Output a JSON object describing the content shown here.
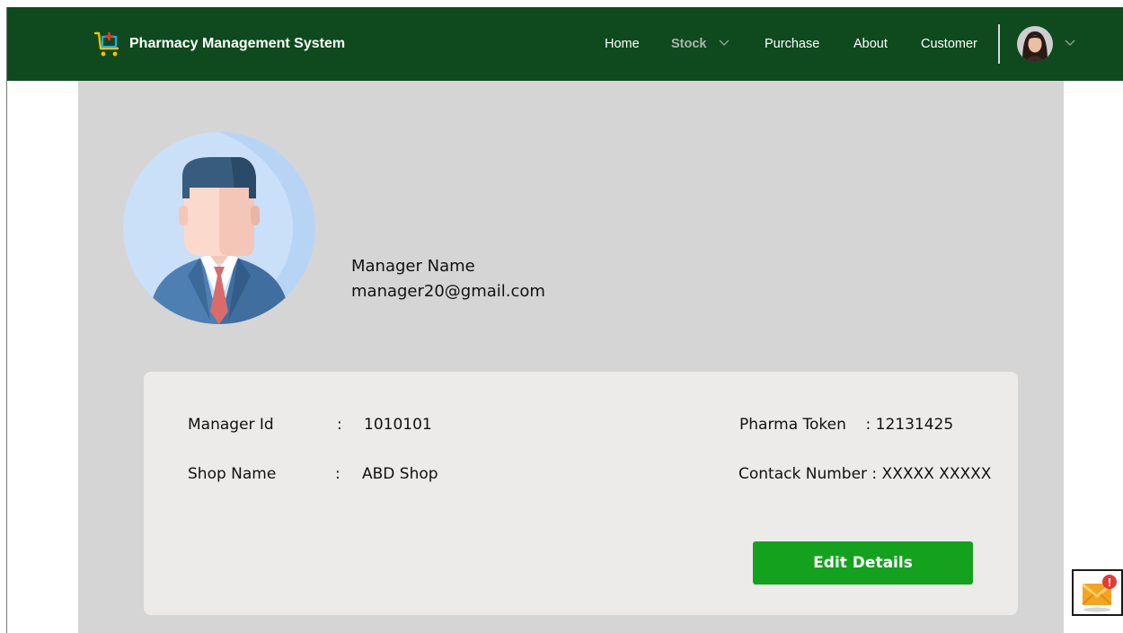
{
  "navbar": {
    "brand_title": "Pharmacy Management System",
    "bg_color": "#0e4a1e",
    "links": {
      "home": "Home",
      "stock": "Stock",
      "purchase": "Purchase",
      "about": "About",
      "customer": "Customer"
    },
    "icons": [
      "pharmacy-cart-logo-icon",
      "chevron-down-icon",
      "user-avatar"
    ]
  },
  "profile": {
    "name": "Manager Name",
    "email": "manager20@gmail.com"
  },
  "details": {
    "separator": ":",
    "manager_id_label": "Manager Id",
    "manager_id_value": "1010101",
    "shop_name_label": "Shop Name",
    "shop_name_value": "ABD Shop",
    "pharma_token": "Pharma Token    : 12131425",
    "contact_number": "Contack Number : XXXXX XXXXX"
  },
  "actions": {
    "edit_label": "Edit Details",
    "button_color": "#14a11e"
  },
  "widgets": {
    "mail_icon": "mail-notification-icon",
    "notification_badge": "!"
  }
}
